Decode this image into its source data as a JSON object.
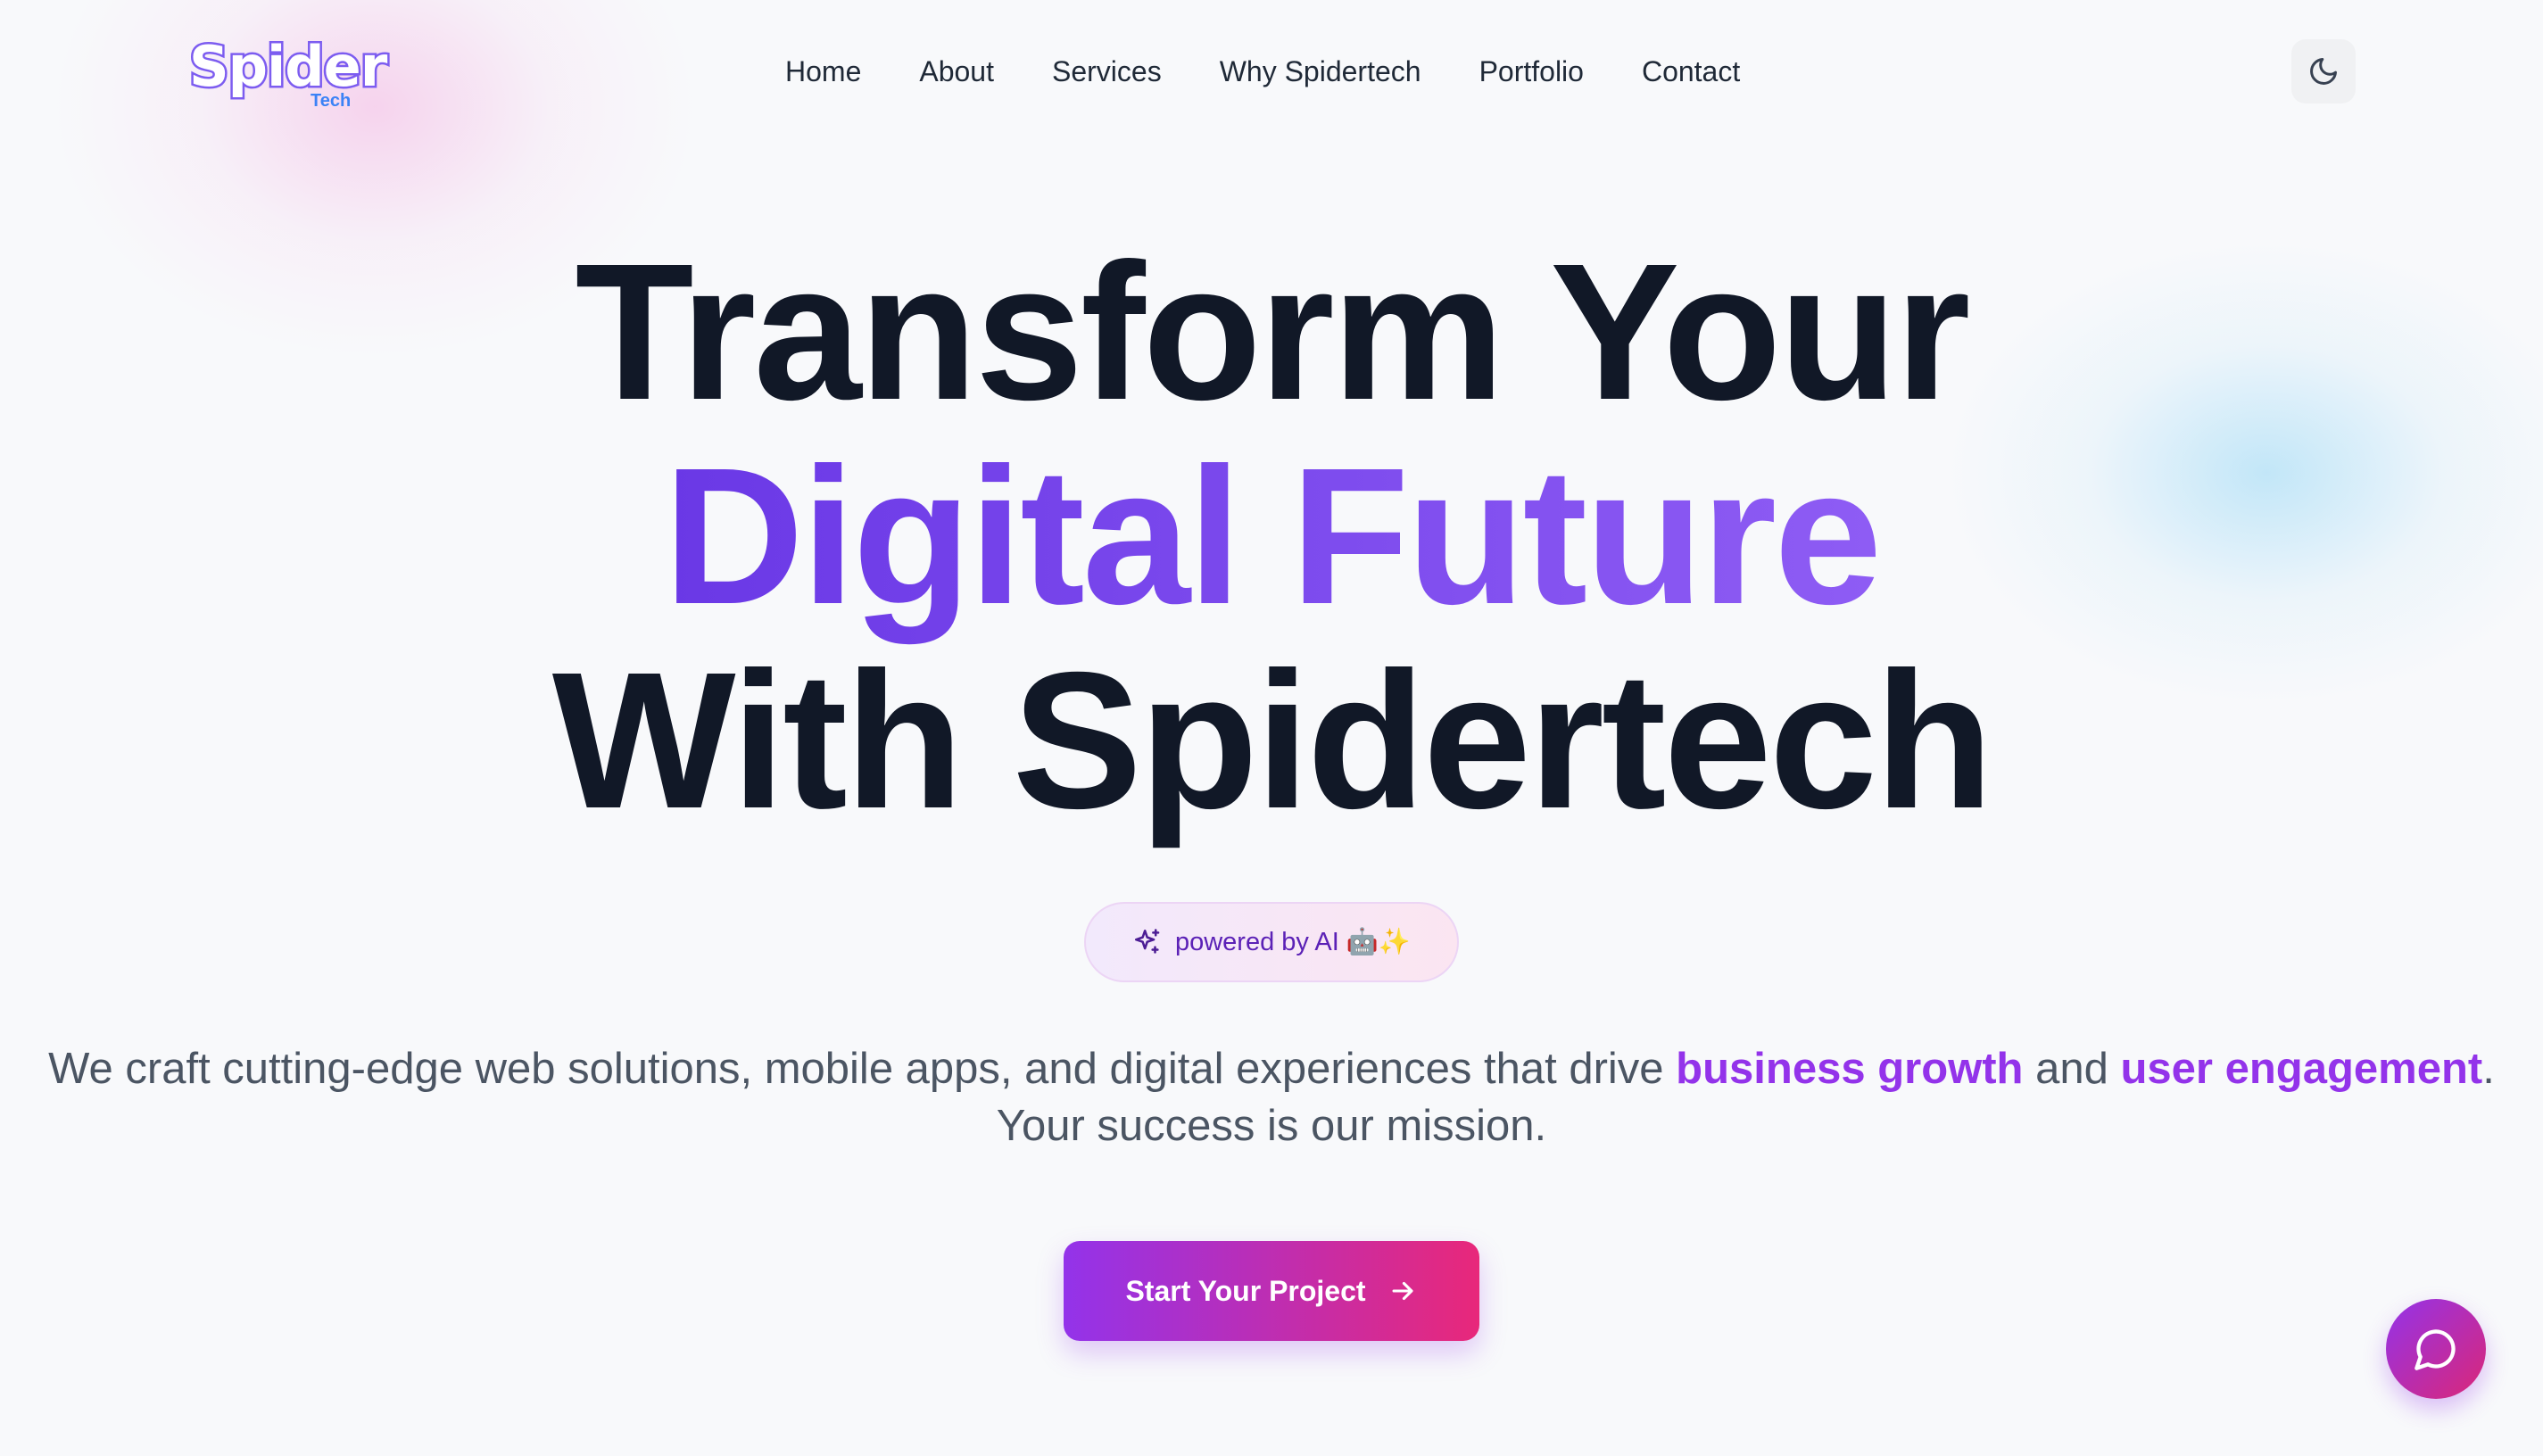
{
  "brand": {
    "logo_text": "Spider",
    "logo_subtext": "Tech"
  },
  "nav": {
    "items": [
      {
        "label": "Home"
      },
      {
        "label": "About"
      },
      {
        "label": "Services"
      },
      {
        "label": "Why Spidertech"
      },
      {
        "label": "Portfolio"
      },
      {
        "label": "Contact"
      }
    ]
  },
  "theme_toggle": {
    "icon": "moon-icon"
  },
  "hero": {
    "line1": "Transform Your",
    "line2": "Digital Future",
    "line3": "With Spidertech",
    "badge": {
      "icon": "sparkles-icon",
      "text": "powered by AI 🤖✨"
    },
    "tagline": {
      "part1": "We craft cutting-edge web solutions, mobile apps, and digital experiences that drive ",
      "highlight1": "business growth",
      "part2": " and ",
      "highlight2": "user engagement",
      "part3": ". Your success is our mission."
    },
    "cta": {
      "label": "Start Your Project",
      "icon": "arrow-right-icon"
    }
  },
  "chat": {
    "icon": "chat-bubble-icon"
  },
  "colors": {
    "accent_purple": "#7c3aed",
    "highlight_purple": "#9333ea",
    "cta_gradient_start": "#9333ea",
    "cta_gradient_end": "#e8287a",
    "heading": "#111827",
    "body_text": "#4b5563"
  }
}
